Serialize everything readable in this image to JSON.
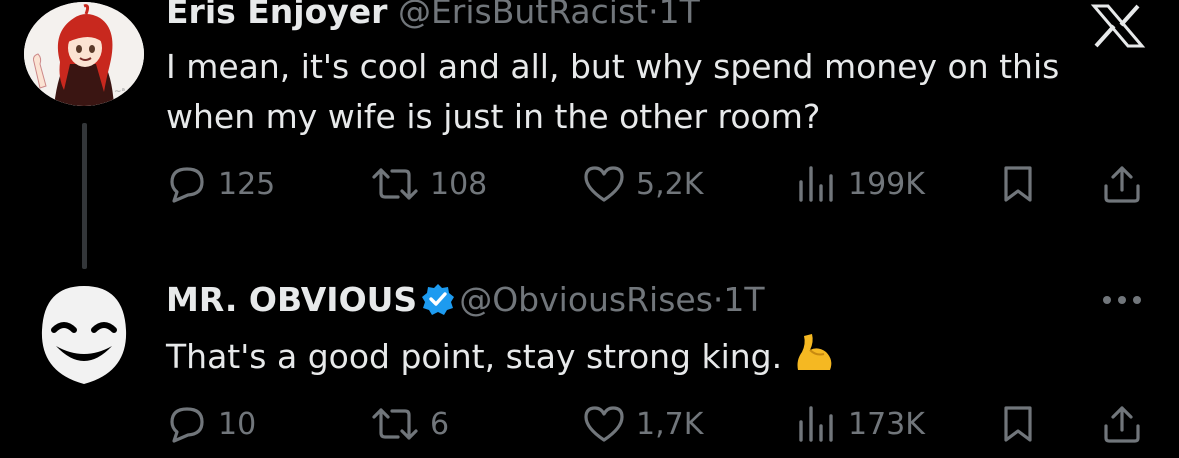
{
  "tweet1": {
    "display_name": "Eris Enjoyer",
    "handle": "@ErisButRacist",
    "separator": "·",
    "time": "1T",
    "text_line1": "I mean, it's cool and all, but why spend money on this",
    "text_line2": "when my wife is just in the other room?",
    "replies": "125",
    "reposts": "108",
    "likes": "5,2K",
    "views": "199K"
  },
  "tweet2": {
    "display_name": "MR. OBVIOUS",
    "handle": "@ObviousRises",
    "separator": "·",
    "time": "1T",
    "text": "That's a good point, stay strong king.",
    "replies": "10",
    "reposts": "6",
    "likes": "1,7K",
    "views": "173K"
  },
  "colors": {
    "background": "#000000",
    "primary_text": "#e7e9ea",
    "secondary_text": "#71767b",
    "verified": "#1d9bf0"
  },
  "icons": [
    "x-logo-icon",
    "reply-icon",
    "repost-icon",
    "like-icon",
    "views-icon",
    "bookmark-icon",
    "share-icon",
    "verified-badge-icon",
    "more-icon",
    "flexed-biceps-emoji"
  ]
}
